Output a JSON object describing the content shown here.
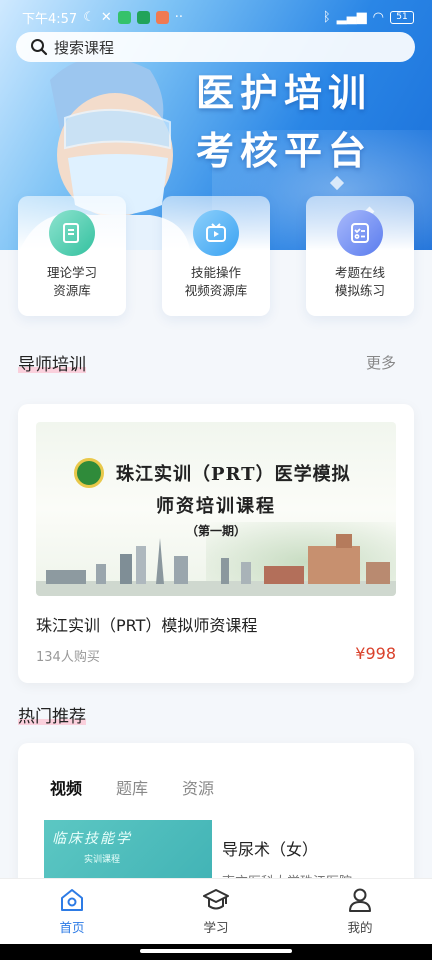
{
  "status_bar": {
    "time": "下午4:57",
    "battery": "51"
  },
  "search": {
    "placeholder": "搜索课程"
  },
  "banner": {
    "line1": "医护培训",
    "line2": "考核平台"
  },
  "quick_entries": [
    {
      "label": "理论学习\n资源库",
      "icon": "document-icon",
      "color": "#36c5a6"
    },
    {
      "label": "技能操作\n视频资源库",
      "icon": "video-play-icon",
      "color": "#3fa7f5"
    },
    {
      "label": "考题在线\n模拟练习",
      "icon": "exam-icon",
      "color": "#5b7ff0"
    }
  ],
  "section_tutor": {
    "title": "导师培训",
    "more": "更多"
  },
  "course": {
    "poster_title": "珠江实训（PRT）医学模拟",
    "poster_subtitle": "师资培训课程",
    "poster_phase": "（第一期）",
    "title": "珠江实训（PRT）模拟师资课程",
    "buyers": "134人购买",
    "price": "¥998"
  },
  "section_hot": {
    "title": "热门推荐"
  },
  "hot": {
    "tabs": [
      "视频",
      "题库",
      "资源"
    ],
    "active_tab": 0,
    "thumb_title": "临床技能学",
    "thumb_sub": "实训课程",
    "video_title": "导尿术（女）",
    "video_sub": "南方医科大学珠江医院"
  },
  "bottom_nav": [
    {
      "label": "首页",
      "icon": "home-icon",
      "active": true
    },
    {
      "label": "学习",
      "icon": "graduation-cap-icon",
      "active": false
    },
    {
      "label": "我的",
      "icon": "user-icon",
      "active": false
    }
  ],
  "colors": {
    "accent": "#2d7be5",
    "price": "#d9412b",
    "banner": "#2a86e6"
  }
}
